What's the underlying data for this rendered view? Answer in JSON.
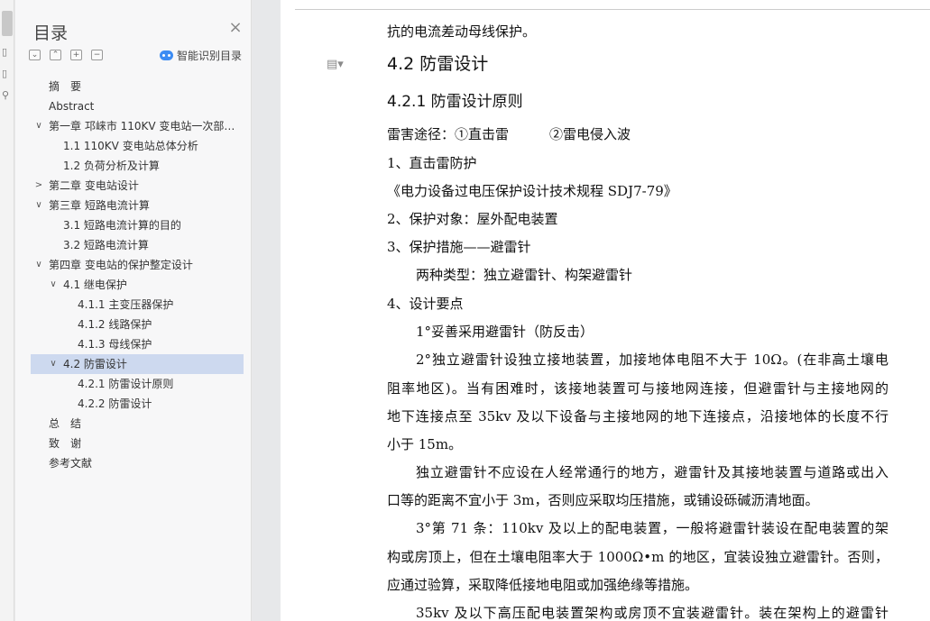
{
  "nav": {
    "title": "目录",
    "close": "×",
    "tools": [
      "⌄",
      "⌃",
      "+",
      "−"
    ],
    "smart_label": "智能识别目录",
    "items": [
      {
        "label": "摘　要",
        "level": 0,
        "chevron": ""
      },
      {
        "label": "Abstract",
        "level": 0,
        "chevron": ""
      },
      {
        "label": "第一章 邛崃市 110KV 变电站一次部…",
        "level": 0,
        "chevron": "∨"
      },
      {
        "label": "1.1 110KV 变电站总体分析",
        "level": 1,
        "chevron": ""
      },
      {
        "label": "1.2 负荷分析及计算",
        "level": 1,
        "chevron": ""
      },
      {
        "label": "第二章 变电站设计",
        "level": 0,
        "chevron": ">"
      },
      {
        "label": "第三章 短路电流计算",
        "level": 0,
        "chevron": "∨"
      },
      {
        "label": "3.1 短路电流计算的目的",
        "level": 1,
        "chevron": ""
      },
      {
        "label": "3.2 短路电流计算",
        "level": 1,
        "chevron": ""
      },
      {
        "label": "第四章 变电站的保护整定设计",
        "level": 0,
        "chevron": "∨"
      },
      {
        "label": "4.1 继电保护",
        "level": 1,
        "chevron": "∨"
      },
      {
        "label": "4.1.1 主变压器保护",
        "level": 2,
        "chevron": ""
      },
      {
        "label": "4.1.2 线路保护",
        "level": 2,
        "chevron": ""
      },
      {
        "label": "4.1.3 母线保护",
        "level": 2,
        "chevron": ""
      },
      {
        "label": "4.2 防雷设计",
        "level": 1,
        "chevron": "∨",
        "selected": true
      },
      {
        "label": "4.2.1 防雷设计原则",
        "level": 2,
        "chevron": ""
      },
      {
        "label": "4.2.2 防雷设计",
        "level": 2,
        "chevron": ""
      },
      {
        "label": "总　结",
        "level": 0,
        "chevron": ""
      },
      {
        "label": "致　谢",
        "level": 0,
        "chevron": ""
      },
      {
        "label": "参考文献",
        "level": 0,
        "chevron": ""
      }
    ]
  },
  "document": {
    "lines": [
      "抗的电流差动母线保护。",
      "4.2  防雷设计",
      "4.2.1 防雷设计原则",
      "雷害途径：①直击雷　　　②雷电侵入波",
      "1、直击雷防护",
      "《电力设备过电压保护设计技术规程 SDJ7-79》",
      "2、保护对象：屋外配电装置",
      "3、保护措施——避雷针",
      "两种类型：独立避雷针、构架避雷针",
      "4、设计要点",
      "1°妥善采用避雷针（防反击）",
      "2°独立避雷针设独立接地装置，加接地体电阻不大于 10Ω。(在非高土壤电",
      "阻率地区)。当有困难时，该接地装置可与接地网连接，但避雷针与主接地网的",
      "地下连接点至 35kv 及以下设备与主接地网的地下连接点，沿接地体的长度不行",
      "小于 15m。",
      "独立避雷针不应设在人经常通行的地方，避雷针及其接地装置与道路或出入",
      "口等的距离不宜小于 3m，否则应采取均压措施，或铺设砾碱沥清地面。",
      "3°第 71 条：110kv 及以上的配电装置，一般将避雷针装设在配电装置的架",
      "构或房顶上，但在土壤电阻率大于 1000Ω•m 的地区，宜装设独立避雷针。否则，",
      "应通过验算，采取降低接地电阻或加强绝缘等措施。",
      "35kv 及以下高压配电装置架构或房顶不宜装避雷针。装在架构上的避雷针"
    ]
  },
  "icons": {
    "paragraph": "paragraph-icon"
  }
}
